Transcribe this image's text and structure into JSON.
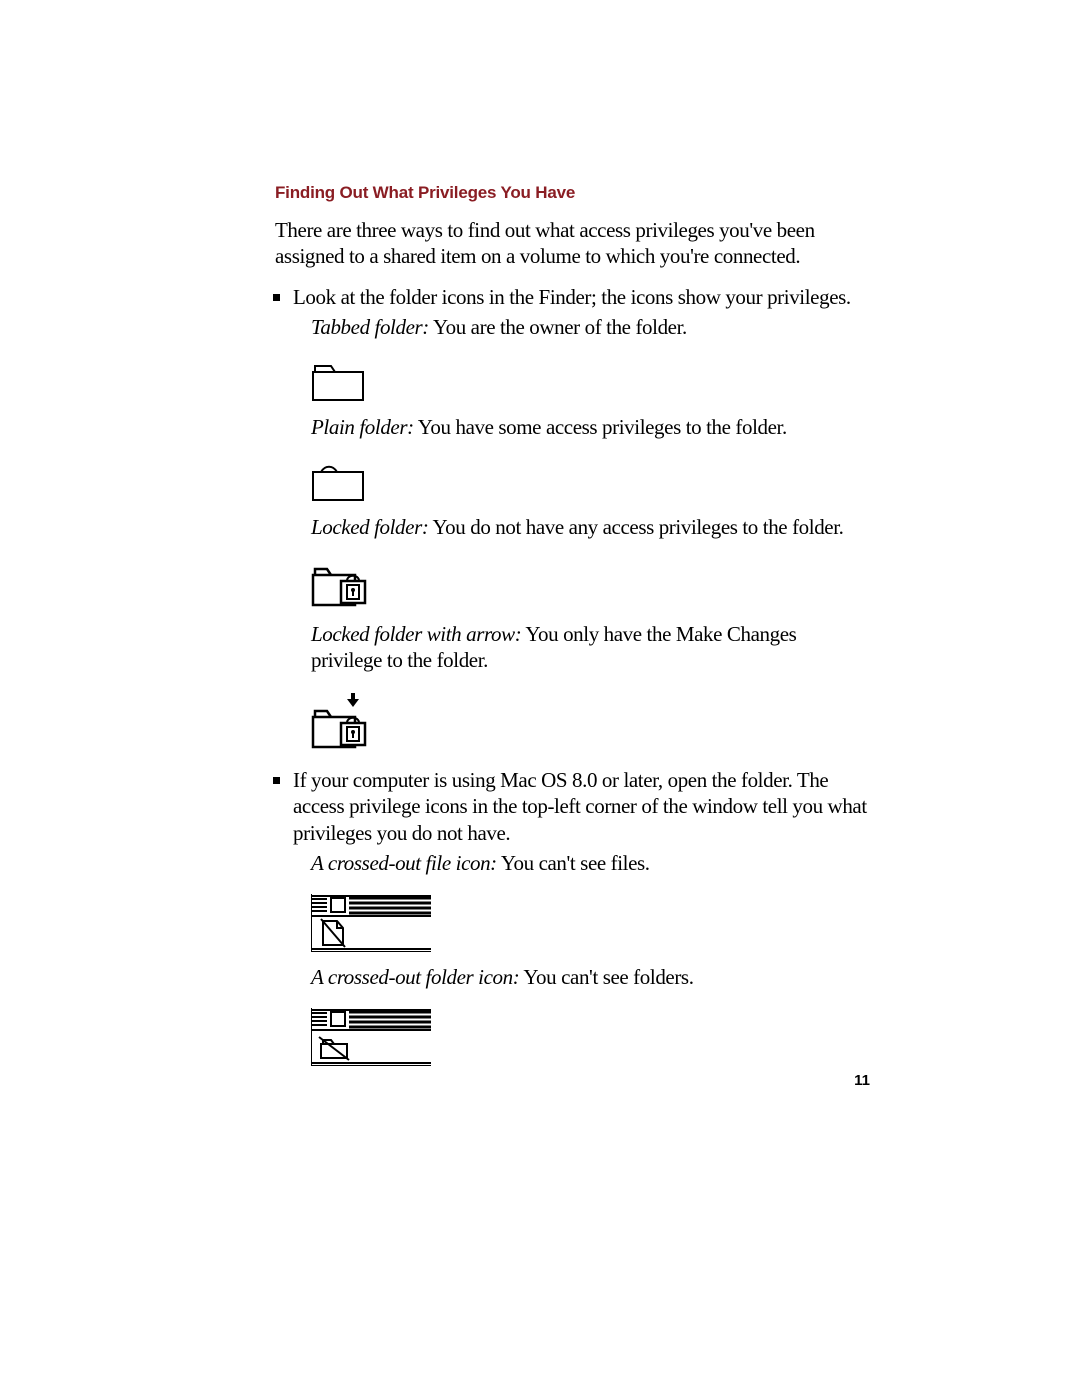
{
  "heading": "Finding Out What Privileges You Have",
  "intro": "There are three ways to find out what access privileges you've been assigned to a shared item on a volume to which you're connected.",
  "bullet1": "Look at the folder icons in the Finder; the icons show your privileges.",
  "tabbed": {
    "label": "Tabbed folder:",
    "text": "  You are the owner of the folder."
  },
  "plain": {
    "label": "Plain folder:",
    "text": "  You have some access privileges to the folder."
  },
  "locked": {
    "label": "Locked folder:",
    "text": "  You do not have any access privileges to the folder."
  },
  "arrow": {
    "label": "Locked folder with arrow:",
    "text": "  You only have the Make Changes privilege to the folder."
  },
  "bullet2": "If your computer is using Mac OS 8.0 or later, open the folder. The access privilege icons in the top-left corner of the window tell you what privileges you do not have.",
  "nofile": {
    "label": "A crossed-out file icon:",
    "text": "  You can't see files."
  },
  "nofolder": {
    "label": "A crossed-out folder icon:",
    "text": "  You can't see folders."
  },
  "pagenum": "11"
}
